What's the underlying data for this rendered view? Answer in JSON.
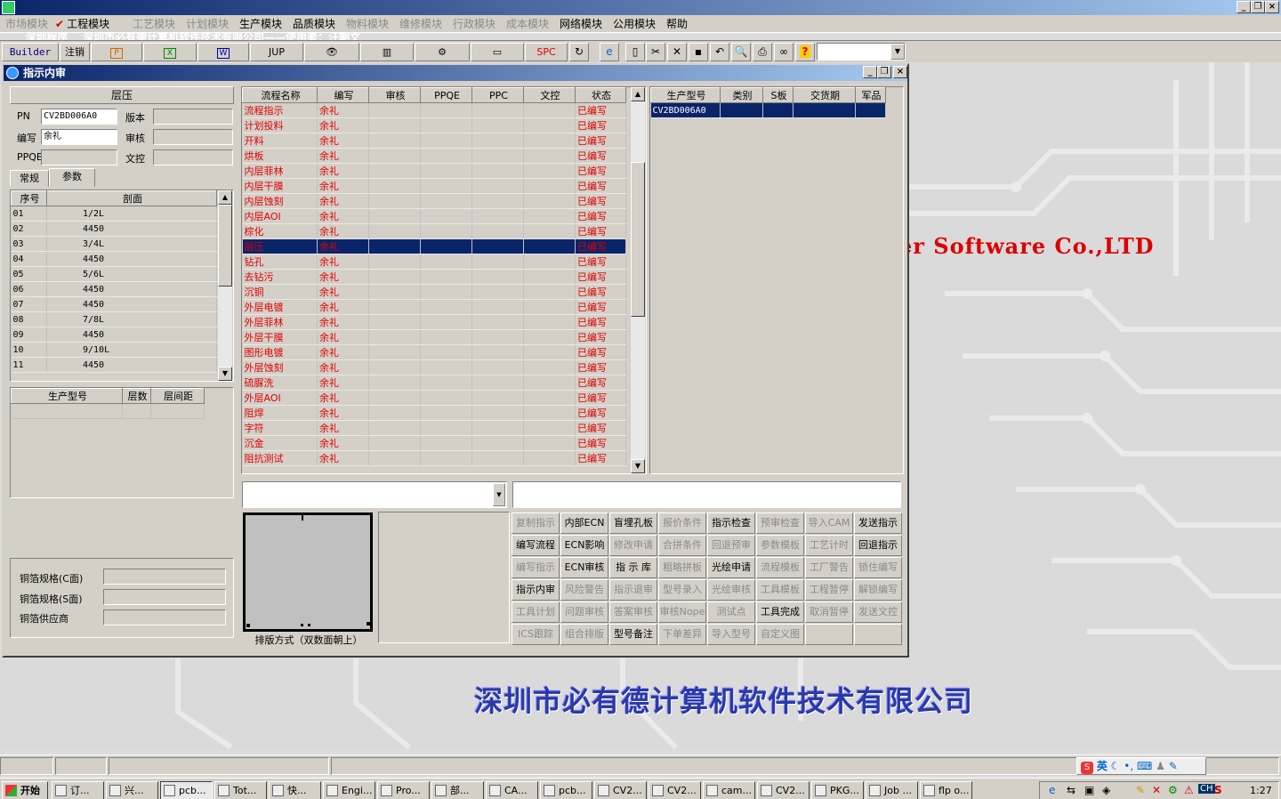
{
  "app": {
    "title": "深圳程序    深圳市必有德计算机软件技术有限公司——使用者：汪朝文"
  },
  "menubar": [
    {
      "label": "市场模块",
      "enabled": false
    },
    {
      "label": "工程模块",
      "enabled": true,
      "checked": true
    },
    {
      "label": "工艺模块",
      "enabled": false
    },
    {
      "label": "计划模块",
      "enabled": false
    },
    {
      "label": "生产模块",
      "enabled": true
    },
    {
      "label": "品质模块",
      "enabled": true
    },
    {
      "label": "物料模块",
      "enabled": false
    },
    {
      "label": "维修模块",
      "enabled": false
    },
    {
      "label": "行政模块",
      "enabled": false
    },
    {
      "label": "成本模块",
      "enabled": false
    },
    {
      "label": "网络模块",
      "enabled": true
    },
    {
      "label": "公用模块",
      "enabled": true
    },
    {
      "label": "帮助",
      "enabled": true
    }
  ],
  "toolbar": {
    "builder": "Builder",
    "logout": "注销",
    "jup": "JUP",
    "spc": "SPC"
  },
  "window": {
    "title": "指示内审"
  },
  "left": {
    "header": "层压",
    "pn_label": "PN",
    "pn_value": "CV2BD006A0",
    "version_label": "版本",
    "version_value": "",
    "editor_label": "编写",
    "editor_value": "余礼",
    "review_label": "审核",
    "review_value": "",
    "ppqe_label": "PPQE",
    "ppqe_value": "",
    "doc_label": "文控",
    "doc_value": "",
    "tabs": [
      "常规",
      "参数"
    ],
    "layer_table": {
      "headers": [
        "序号",
        "剖面"
      ],
      "rows": [
        [
          "01",
          "1/2L"
        ],
        [
          "02",
          "4450"
        ],
        [
          "03",
          "3/4L"
        ],
        [
          "04",
          "4450"
        ],
        [
          "05",
          "5/6L"
        ],
        [
          "06",
          "4450"
        ],
        [
          "07",
          "4450"
        ],
        [
          "08",
          "7/8L"
        ],
        [
          "09",
          "4450"
        ],
        [
          "10",
          "9/10L"
        ],
        [
          "11",
          "4450"
        ]
      ]
    },
    "model_table": {
      "headers": [
        "生产型号",
        "层数",
        "层间距"
      ]
    },
    "copper_c_label": "铜箔规格(C面)",
    "copper_s_label": "铜箔规格(S面)",
    "copper_vendor_label": "铜箔供应商"
  },
  "flow_table": {
    "headers": [
      "流程名称",
      "编写",
      "审核",
      "PPQE",
      "PPC",
      "文控",
      "状态"
    ],
    "selected_index": 9,
    "rows": [
      [
        "流程指示",
        "余礼",
        "",
        "",
        "",
        "",
        "已编写"
      ],
      [
        "计划投料",
        "余礼",
        "",
        "",
        "",
        "",
        "已编写"
      ],
      [
        "开料",
        "余礼",
        "",
        "",
        "",
        "",
        "已编写"
      ],
      [
        "烘板",
        "余礼",
        "",
        "",
        "",
        "",
        "已编写"
      ],
      [
        "内层菲林",
        "余礼",
        "",
        "",
        "",
        "",
        "已编写"
      ],
      [
        "内层干膜",
        "余礼",
        "",
        "",
        "",
        "",
        "已编写"
      ],
      [
        "内层蚀刻",
        "余礼",
        "",
        "",
        "",
        "",
        "已编写"
      ],
      [
        "内层AOI",
        "余礼",
        "",
        "",
        "",
        "",
        "已编写"
      ],
      [
        "棕化",
        "余礼",
        "",
        "",
        "",
        "",
        "已编写"
      ],
      [
        "层压",
        "余礼",
        "",
        "",
        "",
        "",
        "已编写"
      ],
      [
        "钻孔",
        "余礼",
        "",
        "",
        "",
        "",
        "已编写"
      ],
      [
        "去钻污",
        "余礼",
        "",
        "",
        "",
        "",
        "已编写"
      ],
      [
        "沉铜",
        "余礼",
        "",
        "",
        "",
        "",
        "已编写"
      ],
      [
        "外层电镀",
        "余礼",
        "",
        "",
        "",
        "",
        "已编写"
      ],
      [
        "外层菲林",
        "余礼",
        "",
        "",
        "",
        "",
        "已编写"
      ],
      [
        "外层干膜",
        "余礼",
        "",
        "",
        "",
        "",
        "已编写"
      ],
      [
        "图形电镀",
        "余礼",
        "",
        "",
        "",
        "",
        "已编写"
      ],
      [
        "外层蚀刻",
        "余礼",
        "",
        "",
        "",
        "",
        "已编写"
      ],
      [
        "硫脲洗",
        "余礼",
        "",
        "",
        "",
        "",
        "已编写"
      ],
      [
        "外层AOI",
        "余礼",
        "",
        "",
        "",
        "",
        "已编写"
      ],
      [
        "阻焊",
        "余礼",
        "",
        "",
        "",
        "",
        "已编写"
      ],
      [
        "字符",
        "余礼",
        "",
        "",
        "",
        "",
        "已编写"
      ],
      [
        "沉金",
        "余礼",
        "",
        "",
        "",
        "",
        "已编写"
      ],
      [
        "阻抗测试",
        "余礼",
        "",
        "",
        "",
        "",
        "已编写"
      ]
    ]
  },
  "product_table": {
    "headers": [
      "生产型号",
      "类别",
      "S板",
      "交货期",
      "军品"
    ],
    "rows": [
      [
        "CV2BD006A0",
        "",
        "",
        "",
        ""
      ]
    ]
  },
  "layout_caption": "排版方式（双数面朝上）",
  "buttons": [
    [
      {
        "label": "复制指示",
        "enabled": false
      },
      {
        "label": "内部ECN",
        "enabled": true
      },
      {
        "label": "盲埋孔板",
        "enabled": true
      },
      {
        "label": "报价条件",
        "enabled": false
      },
      {
        "label": "指示检查",
        "enabled": true
      },
      {
        "label": "预审检查",
        "enabled": false
      },
      {
        "label": "导入CAM",
        "enabled": false
      },
      {
        "label": "发送指示",
        "enabled": true
      }
    ],
    [
      {
        "label": "编写流程",
        "enabled": true
      },
      {
        "label": "ECN影响",
        "enabled": true
      },
      {
        "label": "修改申请",
        "enabled": false
      },
      {
        "label": "合拼条件",
        "enabled": false
      },
      {
        "label": "回退预审",
        "enabled": false
      },
      {
        "label": "参数模板",
        "enabled": false
      },
      {
        "label": "工艺计时",
        "enabled": false
      },
      {
        "label": "回退指示",
        "enabled": true
      }
    ],
    [
      {
        "label": "编写指示",
        "enabled": false
      },
      {
        "label": "ECN审核",
        "enabled": true
      },
      {
        "label": "指 示 库",
        "enabled": true
      },
      {
        "label": "粗略拼板",
        "enabled": false
      },
      {
        "label": "光绘申请",
        "enabled": true
      },
      {
        "label": "流程模板",
        "enabled": false
      },
      {
        "label": "工厂警告",
        "enabled": false
      },
      {
        "label": "锁住编写",
        "enabled": false
      }
    ],
    [
      {
        "label": "指示内审",
        "enabled": true
      },
      {
        "label": "风险警告",
        "enabled": false
      },
      {
        "label": "指示退审",
        "enabled": false
      },
      {
        "label": "型号录入",
        "enabled": false
      },
      {
        "label": "光绘审核",
        "enabled": false
      },
      {
        "label": "工具模板",
        "enabled": false
      },
      {
        "label": "工程暂停",
        "enabled": false
      },
      {
        "label": "解锁编写",
        "enabled": false
      }
    ],
    [
      {
        "label": "工具计划",
        "enabled": false
      },
      {
        "label": "问题审核",
        "enabled": false
      },
      {
        "label": "答案审核",
        "enabled": false
      },
      {
        "label": "审核Nope",
        "enabled": false
      },
      {
        "label": "测试点",
        "enabled": false
      },
      {
        "label": "工具完成",
        "enabled": true
      },
      {
        "label": "取消暂停",
        "enabled": false
      },
      {
        "label": "发送文控",
        "enabled": false
      }
    ],
    [
      {
        "label": "ICS跟踪",
        "enabled": false
      },
      {
        "label": "组合排版",
        "enabled": false
      },
      {
        "label": "型号备注",
        "enabled": true
      },
      {
        "label": "下单差异",
        "enabled": false
      },
      {
        "label": "导入型号",
        "enabled": false
      },
      {
        "label": "自定义图",
        "enabled": false
      },
      {
        "label": "",
        "enabled": false
      },
      {
        "label": "",
        "enabled": false
      }
    ]
  ],
  "background": {
    "english": "er Software Co.,LTD",
    "chinese": "深圳市必有德计算机软件技术有限公司"
  },
  "ime": {
    "lang": "英"
  },
  "taskbar": {
    "start": "开始",
    "tasks": [
      "订...",
      "兴...",
      "pcb...",
      "Tot...",
      "快...",
      "Engi...",
      "Pro...",
      "部...",
      "CA...",
      "pcb...",
      "CV2...",
      "CV2...",
      "cam...",
      "CV2...",
      "PKG...",
      "Job ...",
      "flp o..."
    ],
    "tray_lang": "CH",
    "clock": "1:27"
  },
  "colors": {
    "title_gradient_start": "#0a246a",
    "title_gradient_end": "#a6caf0",
    "status_red": "#e00000",
    "selection": "#0a246a",
    "face": "#d4d0c8",
    "brand_blue": "#2a3aa8"
  }
}
